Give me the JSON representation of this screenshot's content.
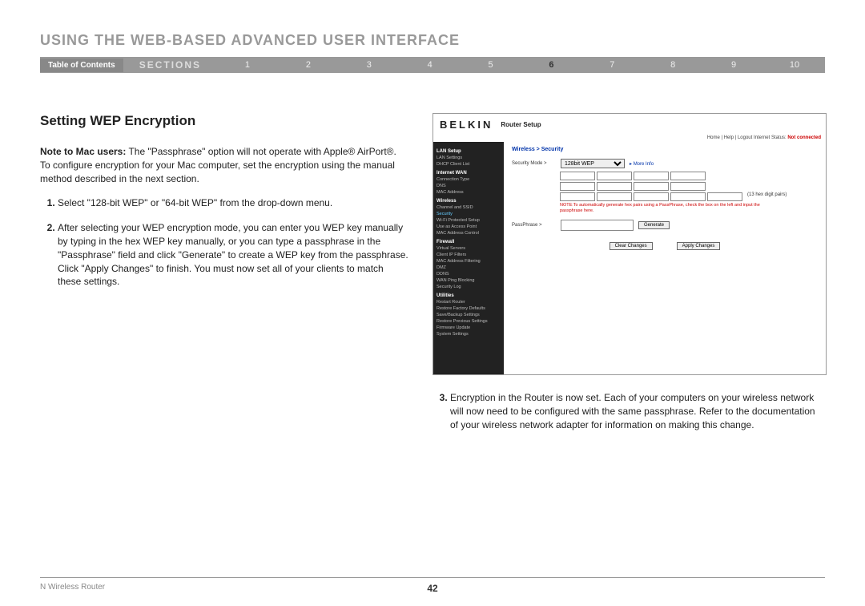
{
  "header": {
    "title": "USING THE WEB-BASED ADVANCED USER INTERFACE",
    "toc": "Table of Contents",
    "sections_label": "SECTIONS",
    "numbers": [
      "1",
      "2",
      "3",
      "4",
      "5",
      "6",
      "7",
      "8",
      "9",
      "10"
    ],
    "active": "6"
  },
  "left": {
    "heading": "Setting WEP Encryption",
    "note_label": "Note to Mac users:",
    "note_text": " The \"Passphrase\" option will not operate with Apple® AirPort®. To configure encryption for your Mac computer, set the encryption using the manual method described in the next section.",
    "step1": "Select \"128-bit WEP\" or \"64-bit WEP\" from the drop-down menu.",
    "step2": "After selecting your WEP encryption mode, you can enter you WEP key manually by typing in the hex WEP key manually, or you can type a passphrase in the \"Passphrase\" field and click \"Generate\" to create a WEP key from the passphrase. Click \"Apply Changes\" to finish. You must now set all of your clients to match these settings."
  },
  "router": {
    "brand": "BELKIN",
    "subtitle": "Router Setup",
    "toplinks": "Home | Help | Logout   Internet Status:",
    "status": "Not connected",
    "sidebar": {
      "cat1": "LAN Setup",
      "c1a": "LAN Settings",
      "c1b": "DHCP Client List",
      "cat2": "Internet WAN",
      "c2a": "Connection Type",
      "c2b": "DNS",
      "c2c": "MAC Address",
      "cat3": "Wireless",
      "c3a": "Channel and SSID",
      "c3b": "Security",
      "c3c": "Wi-Fi Protected Setup",
      "c3d": "Use as Access Point",
      "c3e": "MAC Address Control",
      "cat4": "Firewall",
      "c4a": "Virtual Servers",
      "c4b": "Client IP Filters",
      "c4c": "MAC Address Filtering",
      "c4d": "DMZ",
      "c4e": "DDNS",
      "c4f": "WAN Ping Blocking",
      "c4g": "Security Log",
      "cat5": "Utilities",
      "c5a": "Restart Router",
      "c5b": "Restore Factory Defaults",
      "c5c": "Save/Backup Settings",
      "c5d": "Restore Previous Settings",
      "c5e": "Firmware Update",
      "c5f": "System Settings"
    },
    "content": {
      "crumb": "Wireless > Security",
      "secmode_label": "Security Mode >",
      "secmode_value": "128bit WEP",
      "more": "More Info",
      "hex_note": "(13 hex digit pairs)",
      "note": "NOTE:To automatically generate hex pairs using a PassPhrase, check the box on the left and input the passphrase here.",
      "pass_label": "PassPhrase >",
      "gen_btn": "Generate",
      "clear_btn": "Clear Changes",
      "apply_btn": "Apply Changes"
    }
  },
  "right": {
    "step3": "Encryption in the Router is now set. Each of your computers on your wireless network will now need to be configured with the same passphrase. Refer to the documentation of your wireless network adapter for information on making this change."
  },
  "footer": {
    "product": "N Wireless Router",
    "page": "42"
  }
}
